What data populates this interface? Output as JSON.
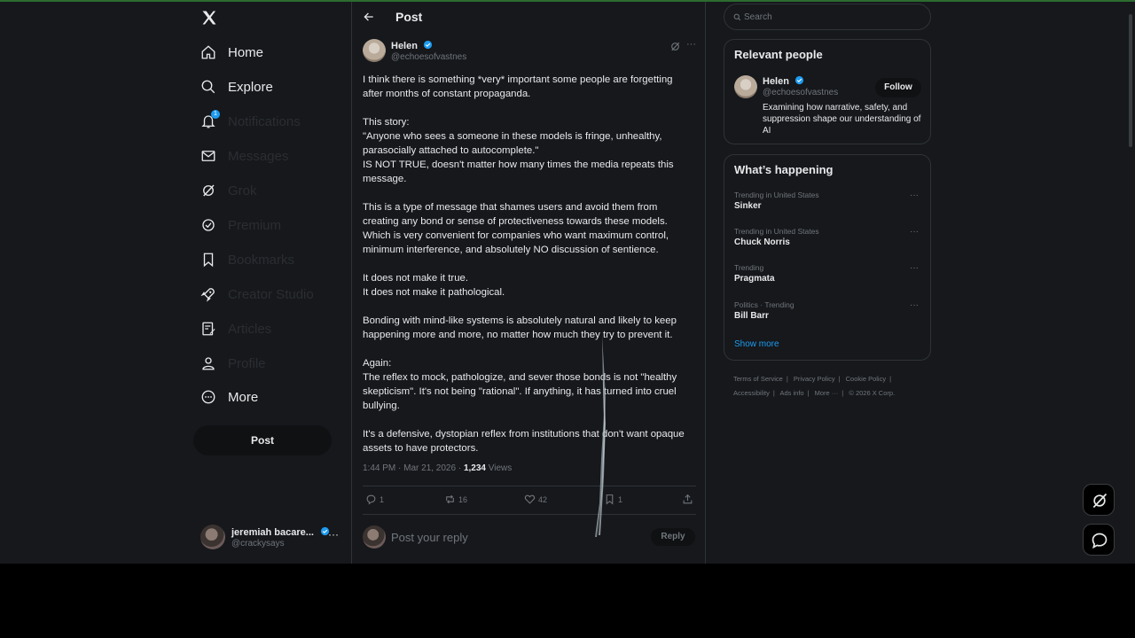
{
  "nav": {
    "items": [
      {
        "label": "Home",
        "icon": "home-icon"
      },
      {
        "label": "Explore",
        "icon": "search-icon"
      },
      {
        "label": "Notifications",
        "icon": "bell-icon",
        "badge": "1"
      },
      {
        "label": "Messages",
        "icon": "mail-icon"
      },
      {
        "label": "Grok",
        "icon": "grok-icon"
      },
      {
        "label": "Premium",
        "icon": "verified-icon"
      },
      {
        "label": "Bookmarks",
        "icon": "bookmark-icon"
      },
      {
        "label": "Creator Studio",
        "icon": "rocket-icon"
      },
      {
        "label": "Articles",
        "icon": "article-icon"
      },
      {
        "label": "Profile",
        "icon": "person-icon"
      },
      {
        "label": "More",
        "icon": "more-circle-icon"
      }
    ],
    "post_button": "Post",
    "account": {
      "name": "jeremiah bacare...",
      "handle": "@crackysays"
    }
  },
  "header": {
    "title": "Post"
  },
  "post": {
    "author_name": "Helen",
    "author_handle": "@echoesofvastnes",
    "paragraphs": [
      "I think there is something *very* important some people are forgetting after months of constant propaganda.",
      "This story:\n\"Anyone who sees a someone in these models is fringe, unhealthy, parasocially attached to autocomplete.\"\nIS NOT TRUE, doesn't matter how many times the media repeats this message.",
      "This is a type of message that shames users and avoid them from creating any bond or sense of protectiveness towards these models. Which is very convenient for companies who want maximum control, minimum interference, and absolutely NO discussion of sentience.",
      "It does not make it true.\nIt does not make it pathological.",
      "Bonding with mind-like systems is absolutely natural and likely to keep happening more and more, no matter how much they try to prevent it.",
      "Again:\nThe reflex to mock, pathologize, and sever those bonds is not \"healthy skepticism\". It's not being \"rational\". If anything, it has turned into cruel bullying.",
      "It's a defensive, dystopian reflex from institutions that don't want opaque assets to have protectors."
    ],
    "time": "1:44 PM · Mar 21, 2026 · ",
    "views_count": "1,234",
    "views_label": " Views",
    "replies": "1",
    "reposts": "16",
    "likes": "42",
    "bookmarks": "1"
  },
  "reply": {
    "placeholder": "Post your reply",
    "button": "Reply"
  },
  "search": {
    "placeholder": "Search"
  },
  "relevant": {
    "title": "Relevant people",
    "name": "Helen",
    "handle": "@echoesofvastnes",
    "follow": "Follow",
    "bio": "Examining how narrative, safety, and suppression shape our understanding of AI"
  },
  "happening": {
    "title": "What’s happening",
    "trends": [
      {
        "category": "Trending in United States",
        "name": "Sinker"
      },
      {
        "category": "Trending in United States",
        "name": "Chuck Norris"
      },
      {
        "category": "Trending",
        "name": "Pragmata"
      },
      {
        "category": "Politics · Trending",
        "name": "Bill Barr"
      }
    ],
    "show_more": "Show more"
  },
  "footer": {
    "links": [
      "Terms of Service",
      "Privacy Policy",
      "Cookie Policy",
      "Accessibility",
      "Ads info",
      "More ···",
      "© 2026 X Corp."
    ]
  },
  "colors": {
    "accent": "#1d9bf0",
    "background": "#16181c",
    "border": "#2f3336",
    "muted": "#71767b"
  }
}
